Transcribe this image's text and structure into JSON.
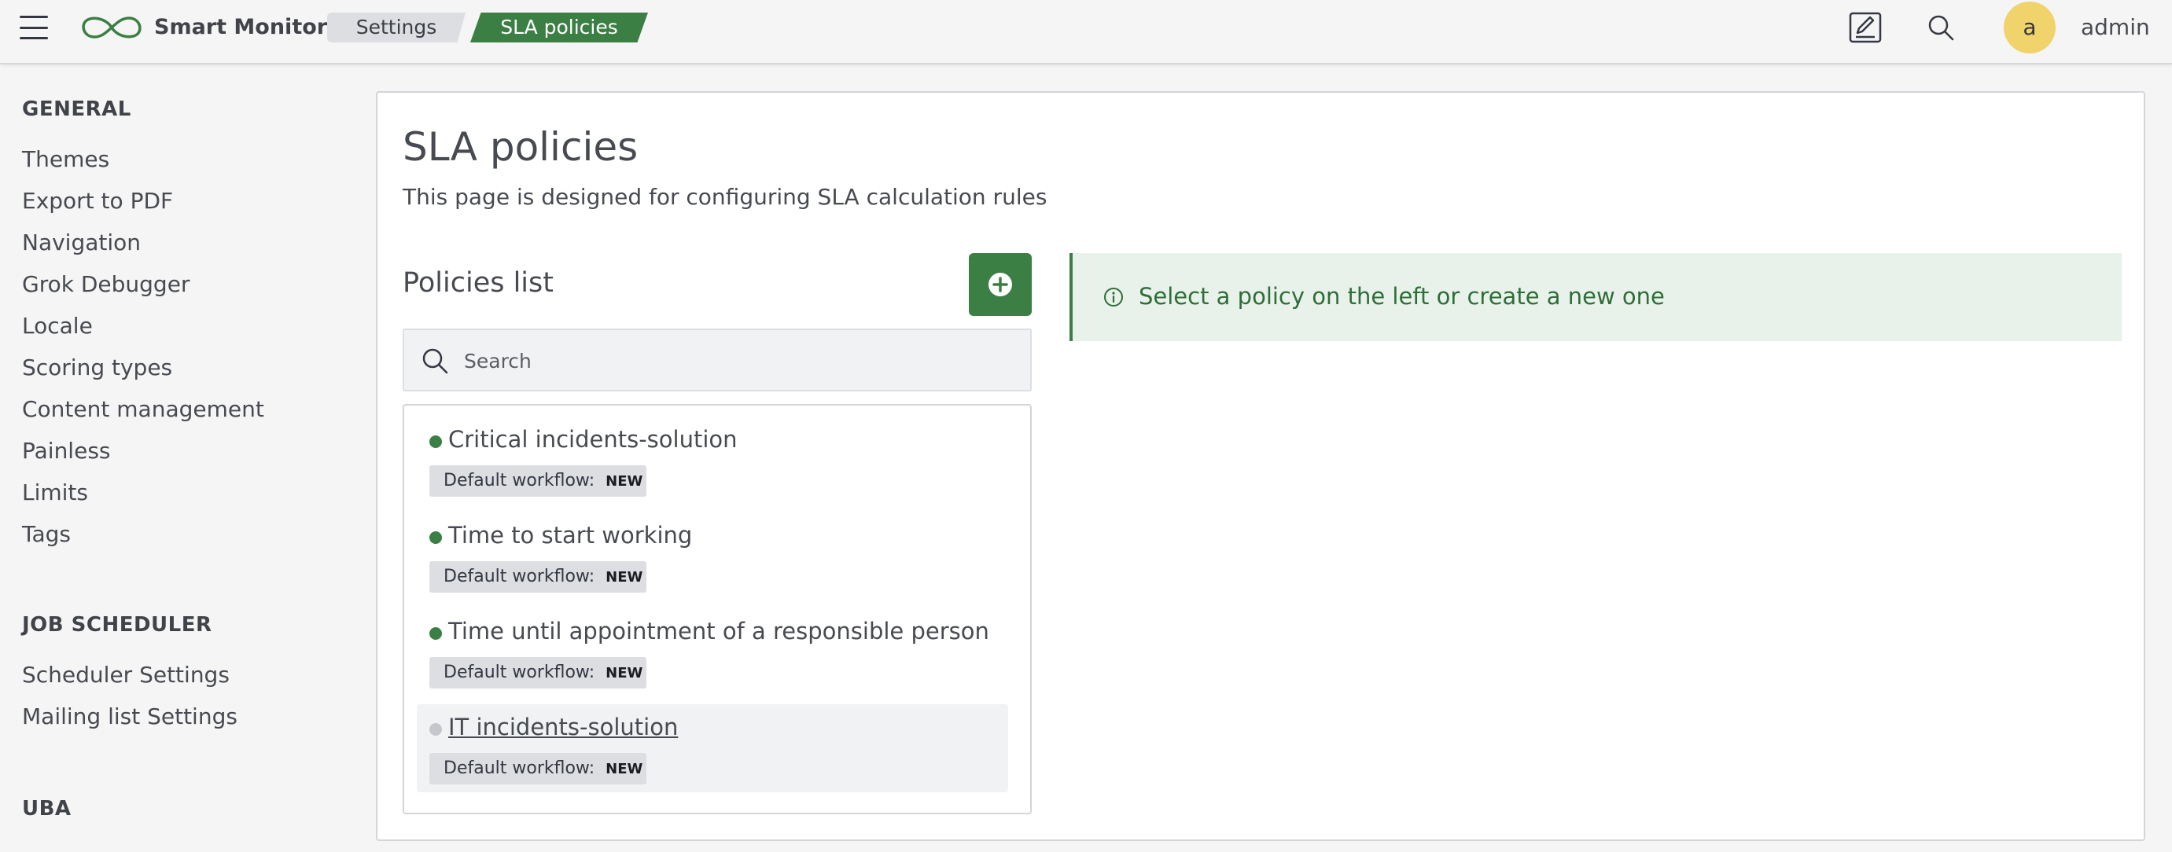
{
  "header": {
    "app_name": "Smart Monitor",
    "breadcrumbs": [
      "Settings",
      "SLA policies"
    ],
    "icons": {
      "menu": "hamburger-menu-icon",
      "logo": "infinity-logo-icon",
      "edit": "edit-note-icon",
      "search": "search-icon"
    },
    "user": {
      "avatar_letter": "a",
      "name": "admin"
    }
  },
  "sidebar": {
    "sections": [
      {
        "title": "GENERAL",
        "items": [
          "Themes",
          "Export to PDF",
          "Navigation",
          "Grok Debugger",
          "Locale",
          "Scoring types",
          "Content management",
          "Painless",
          "Limits",
          "Tags"
        ]
      },
      {
        "title": "JOB SCHEDULER",
        "items": [
          "Scheduler Settings",
          "Mailing list Settings"
        ]
      },
      {
        "title": "UBA",
        "items": []
      }
    ]
  },
  "main": {
    "title": "SLA policies",
    "subtitle": "This page is designed for configuring SLA calculation rules",
    "list_title": "Policies list",
    "add_button_icon": "plus-circle-icon",
    "search": {
      "placeholder": "Search",
      "value": ""
    },
    "policies": [
      {
        "name": "Critical incidents-solution",
        "status": "active",
        "badge_label": "Default workflow:",
        "badge_value": "NEW"
      },
      {
        "name": "Time to start working",
        "status": "active",
        "badge_label": "Default workflow:",
        "badge_value": "NEW"
      },
      {
        "name": "Time until appointment of a responsible person",
        "status": "active",
        "badge_label": "Default workflow:",
        "badge_value": "NEW"
      },
      {
        "name": "IT incidents-solution",
        "status": "inactive",
        "selected": true,
        "badge_label": "Default workflow:",
        "badge_value": "NEW"
      }
    ],
    "callout": {
      "icon": "info-icon",
      "text": "Select a policy on the left or create a new one"
    }
  },
  "colors": {
    "accent_green": "#3b7f44",
    "callout_bg": "#e8f1ea",
    "avatar_bg": "#f0d36a",
    "inactive_dot": "#c5c7cc"
  }
}
